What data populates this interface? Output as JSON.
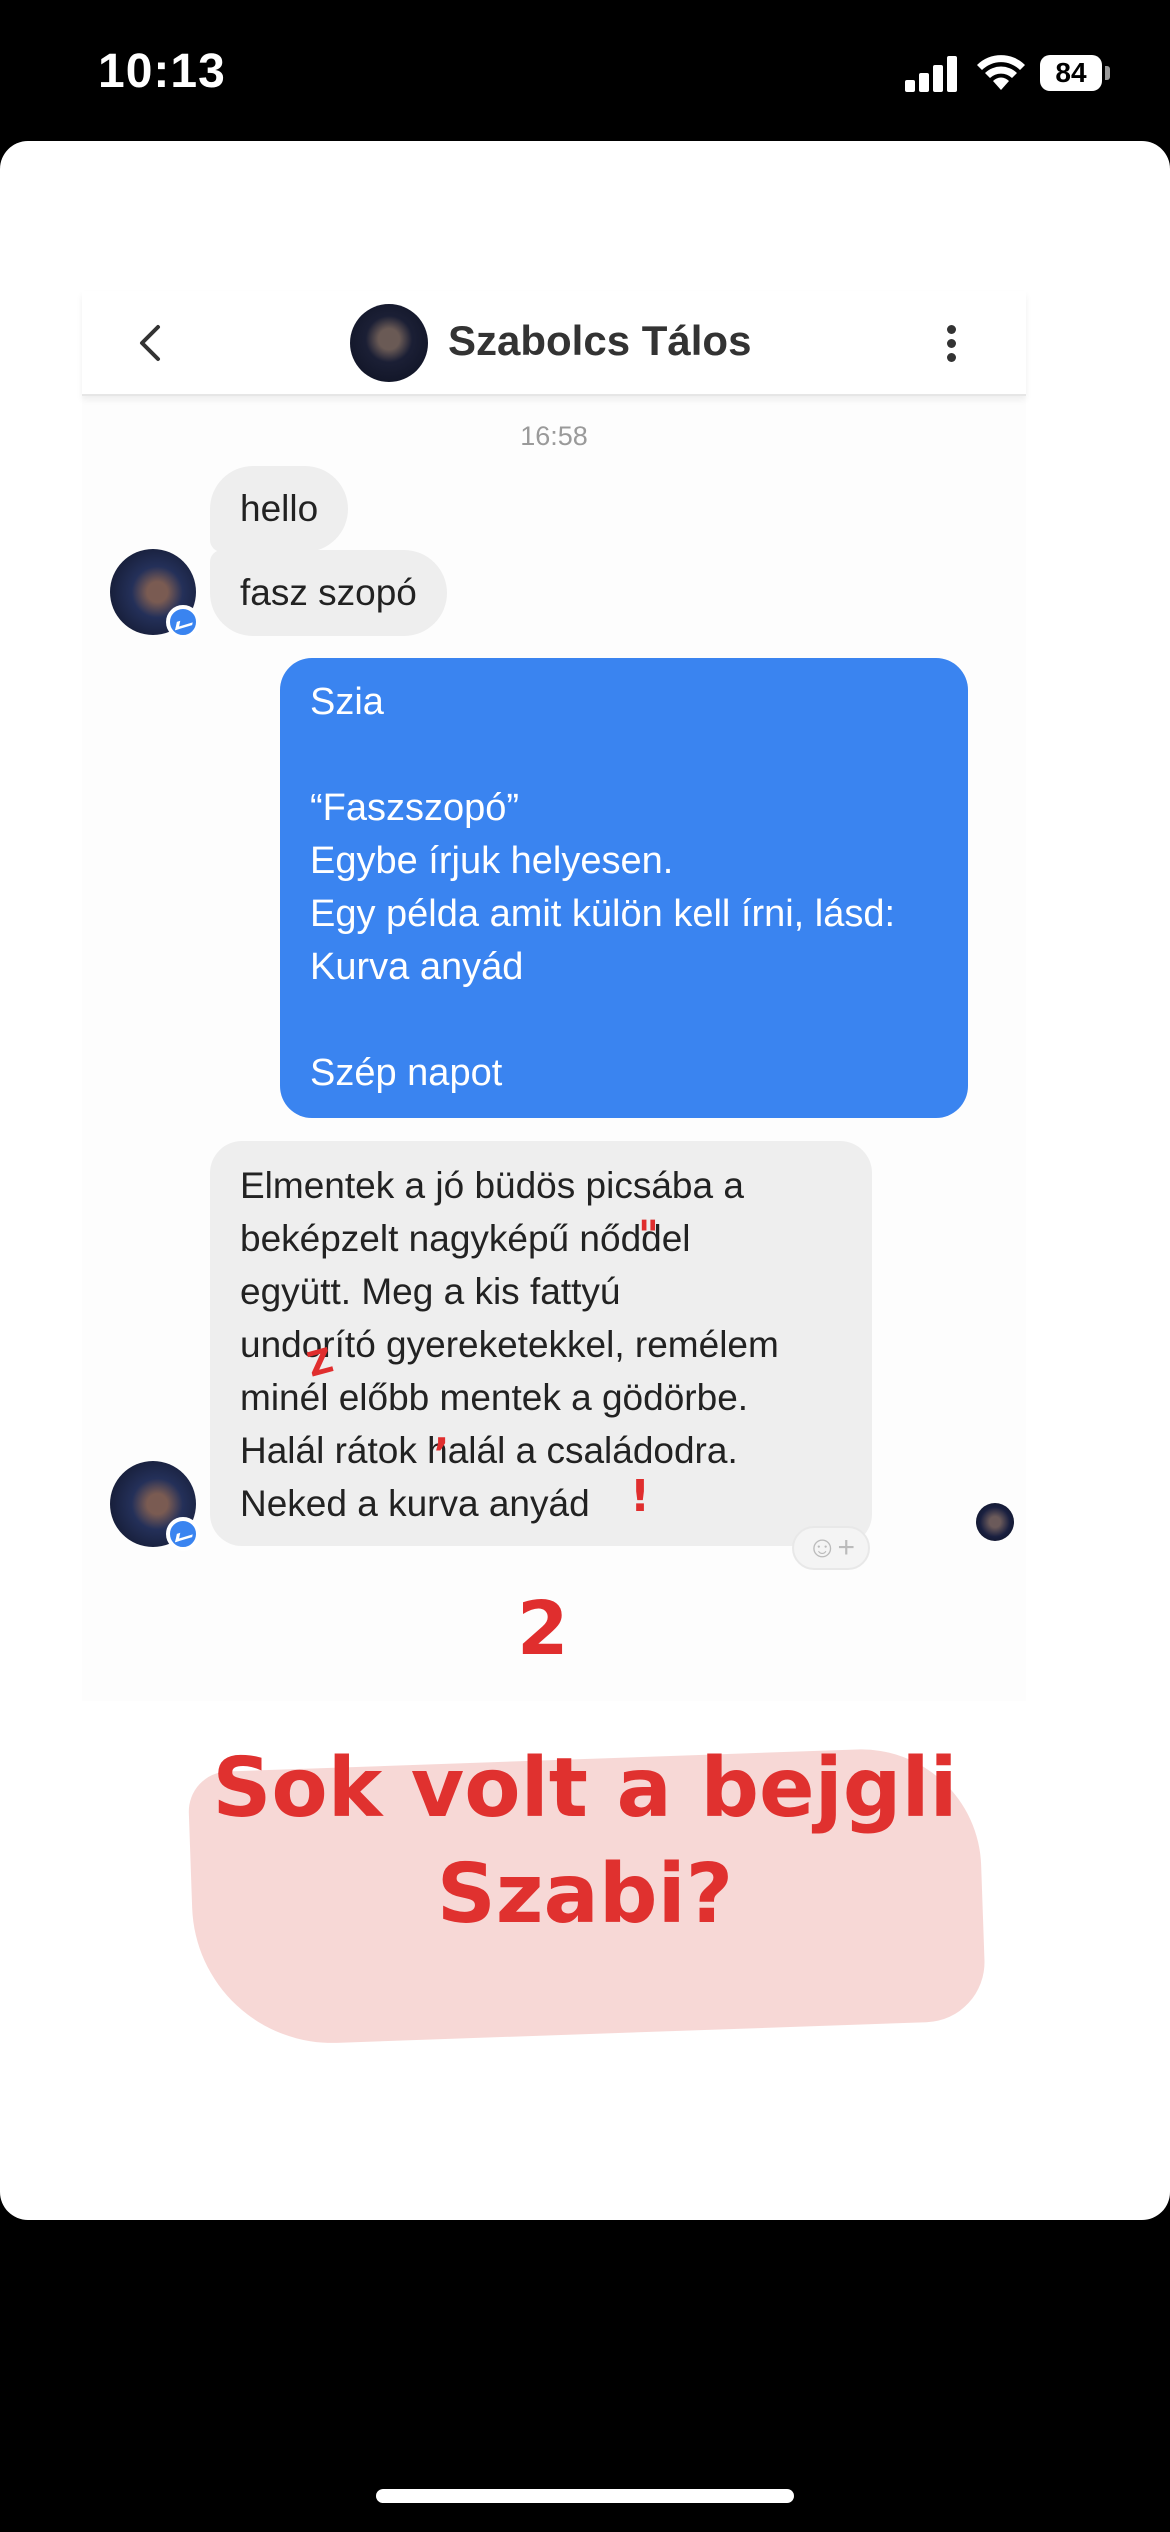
{
  "status_bar": {
    "time": "10:13",
    "battery": "84"
  },
  "chat": {
    "contact_name": "Szabolcs Tálos",
    "timestamp": "16:58",
    "messages": [
      {
        "from": "contact",
        "text": "hello"
      },
      {
        "from": "contact",
        "text": "fasz szopó"
      },
      {
        "from": "me",
        "text": "Szia\n\n“Faszszopó”\nEgybe írjuk helyesen.\nEgy példa amit külön kell írni, lásd:\nKurva anyád\n\nSzép napot"
      },
      {
        "from": "contact",
        "text": "Elmentek a jó büdös picsába a\nbeképzelt nagyképű nőddel\negyütt.  Meg a kis fattyú\nundorító gyereketekkel, remélem\nminél előbb mentek a gödörbe.\nHalál rátok halál a családodra.\nNeked a kurva anyád"
      }
    ],
    "icons": {
      "back": "chevron-left-icon",
      "more": "more-vertical-icon",
      "reaction": "add-reaction-icon",
      "badge": "messenger-icon"
    }
  },
  "annotations": {
    "grade": "2",
    "marks": [
      "\"",
      "Z",
      ",",
      "!"
    ]
  },
  "caption": {
    "line1": "Sok volt a bejgli",
    "line2": "Szabi?"
  },
  "colors": {
    "bubble_me": "#3a84f0",
    "bubble_contact": "#eeeeee",
    "annotation": "#e02e2e",
    "caption_highlight": "#f7d6d4"
  }
}
